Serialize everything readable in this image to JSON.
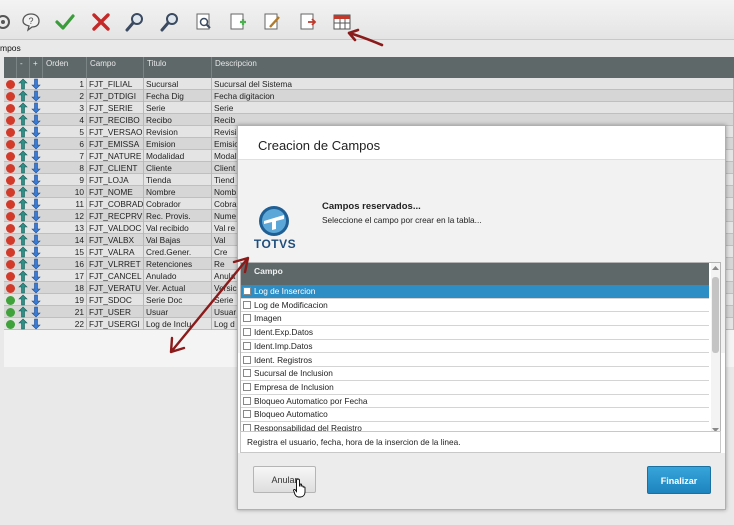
{
  "toolbar": {
    "buttons": [
      {
        "icon": "gear-icon"
      },
      {
        "icon": "help-icon"
      },
      {
        "icon": "checkmark-icon"
      },
      {
        "icon": "delete-x-icon"
      },
      {
        "icon": "search-icon"
      },
      {
        "icon": "search-icon"
      },
      {
        "icon": "preview-icon"
      },
      {
        "icon": "add-document-icon"
      },
      {
        "icon": "edit-document-icon"
      },
      {
        "icon": "export-icon"
      },
      {
        "icon": "table-calendar-icon"
      }
    ]
  },
  "tab_label": "mpos",
  "grid": {
    "columns": [
      "-",
      "+",
      "Orden",
      "Campo",
      "Titulo",
      "Descripcion"
    ],
    "rows": [
      {
        "status": "red",
        "orden": "1",
        "campo": "FJT_FILIAL",
        "titulo": "Sucursal",
        "descripcion": "Sucursal del Sistema"
      },
      {
        "status": "red",
        "orden": "2",
        "campo": "FJT_DTDIGI",
        "titulo": "Fecha Dig",
        "descripcion": "Fecha digitacion"
      },
      {
        "status": "red",
        "orden": "3",
        "campo": "FJT_SERIE",
        "titulo": "Serie",
        "descripcion": "Serie"
      },
      {
        "status": "red",
        "orden": "4",
        "campo": "FJT_RECIBO",
        "titulo": "Recibo",
        "descripcion": "Recib"
      },
      {
        "status": "red",
        "orden": "5",
        "campo": "FJT_VERSAO",
        "titulo": "Revision",
        "descripcion": "Revisi"
      },
      {
        "status": "red",
        "orden": "6",
        "campo": "FJT_EMISSA",
        "titulo": "Emision",
        "descripcion": "Emisio"
      },
      {
        "status": "red",
        "orden": "7",
        "campo": "FJT_NATURE",
        "titulo": "Modalidad",
        "descripcion": "Modal"
      },
      {
        "status": "red",
        "orden": "8",
        "campo": "FJT_CLIENT",
        "titulo": "Cliente",
        "descripcion": "Client"
      },
      {
        "status": "red",
        "orden": "9",
        "campo": "FJT_LOJA",
        "titulo": "Tienda",
        "descripcion": "Tiend"
      },
      {
        "status": "red",
        "orden": "10",
        "campo": "FJT_NOME",
        "titulo": "Nombre",
        "descripcion": "Nomb"
      },
      {
        "status": "red",
        "orden": "11",
        "campo": "FJT_COBRAD",
        "titulo": "Cobrador",
        "descripcion": "Cobra"
      },
      {
        "status": "red",
        "orden": "12",
        "campo": "FJT_RECPRV",
        "titulo": "Rec. Provis.",
        "descripcion": "Nume"
      },
      {
        "status": "red",
        "orden": "13",
        "campo": "FJT_VALDOC",
        "titulo": "Val recibido",
        "descripcion": "Val re"
      },
      {
        "status": "red",
        "orden": "14",
        "campo": "FJT_VALBX",
        "titulo": "Val Bajas",
        "descripcion": "Val"
      },
      {
        "status": "red",
        "orden": "15",
        "campo": "FJT_VALRA",
        "titulo": "Cred.Gener.",
        "descripcion": "Cre"
      },
      {
        "status": "red",
        "orden": "16",
        "campo": "FJT_VLRRET",
        "titulo": "Retenciones",
        "descripcion": "Re"
      },
      {
        "status": "red",
        "orden": "17",
        "campo": "FJT_CANCEL",
        "titulo": "Anulado",
        "descripcion": "Anula"
      },
      {
        "status": "red",
        "orden": "18",
        "campo": "FJT_VERATU",
        "titulo": "Ver. Actual",
        "descripcion": "Versic"
      },
      {
        "status": "green",
        "orden": "19",
        "campo": "FJT_SDOC",
        "titulo": "Serie Doc",
        "descripcion": "Serie"
      },
      {
        "status": "green",
        "orden": "21",
        "campo": "FJT_USER",
        "titulo": "Usuar",
        "descripcion": "Usuar"
      },
      {
        "status": "green",
        "orden": "22",
        "campo": "FJT_USERGI",
        "titulo": "Log de Inclu",
        "descripcion": "Log d"
      }
    ]
  },
  "dialog": {
    "title": "Creacion de Campos",
    "heading": "Campos reservados...",
    "subtitle": "Seleccione el campo por crear en la tabla...",
    "logo_text": "TOTVS",
    "list_header": "Campo",
    "fields": [
      {
        "label": "Log de Insercion",
        "selected": true
      },
      {
        "label": "Log de Modificacion",
        "selected": false
      },
      {
        "label": "Imagen",
        "selected": false
      },
      {
        "label": "Ident.Exp.Datos",
        "selected": false
      },
      {
        "label": "Ident.Imp.Datos",
        "selected": false
      },
      {
        "label": "Ident. Registros",
        "selected": false
      },
      {
        "label": "Sucursal de Inclusion",
        "selected": false
      },
      {
        "label": "Empresa de Inclusion",
        "selected": false
      },
      {
        "label": "Bloqueo Automatico por Fecha",
        "selected": false
      },
      {
        "label": "Bloqueo Automatico",
        "selected": false
      },
      {
        "label": "Responsabilidad del Registro",
        "selected": false
      }
    ],
    "description": "Registra el usuario, fecha, hora de la insercion de la linea.",
    "cancel_label": "Anular",
    "finish_label": "Finalizar"
  },
  "colors": {
    "accent": "#2d8dc5",
    "header_bg": "#5e6869",
    "status_red": "#d23a2a",
    "status_green": "#3fa23a",
    "annotation": "#8b1a1a"
  }
}
